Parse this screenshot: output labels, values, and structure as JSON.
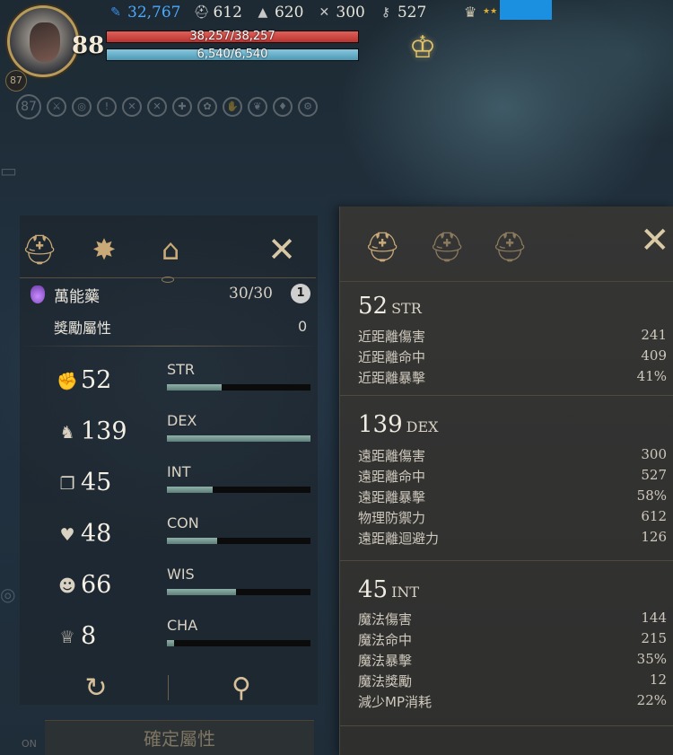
{
  "hud": {
    "level": "88",
    "small_badge": "87",
    "resources": [
      {
        "icon": "feather-icon",
        "value": "32,767"
      },
      {
        "icon": "helmet-icon",
        "value": "612"
      },
      {
        "icon": "wizard-hat-icon",
        "value": "620"
      },
      {
        "icon": "crossbow-icon",
        "value": "300"
      },
      {
        "icon": "crossed-keys-icon",
        "value": "527"
      }
    ],
    "hp": "38,257/38,257",
    "mp": "6,540/6,540"
  },
  "left_panel": {
    "potion": {
      "label": "萬能藥",
      "count": "30/30",
      "info": "1"
    },
    "bonus": {
      "label": "獎勵屬性",
      "value": "0"
    },
    "stats": [
      {
        "name": "STR",
        "value": "52",
        "icon": "muscle-icon",
        "fill": 0.38
      },
      {
        "name": "DEX",
        "value": "139",
        "icon": "boot-icon",
        "fill": 1.0
      },
      {
        "name": "INT",
        "value": "45",
        "icon": "book-icon",
        "fill": 0.32
      },
      {
        "name": "CON",
        "value": "48",
        "icon": "heartbeat-icon",
        "fill": 0.35
      },
      {
        "name": "WIS",
        "value": "66",
        "icon": "head-icon",
        "fill": 0.48
      },
      {
        "name": "CHA",
        "value": "8",
        "icon": "crown-icon",
        "fill": 0.05
      }
    ],
    "confirm_label": "確定屬性",
    "toggle_label": "ON"
  },
  "right_panel": {
    "sections": [
      {
        "value": "52",
        "abbr": "STR",
        "lines": [
          {
            "label": "近距離傷害",
            "value": "241"
          },
          {
            "label": "近距離命中",
            "value": "409"
          },
          {
            "label": "近距離暴擊",
            "value": "41%"
          }
        ]
      },
      {
        "value": "139",
        "abbr": "DEX",
        "lines": [
          {
            "label": "遠距離傷害",
            "value": "300"
          },
          {
            "label": "遠距離命中",
            "value": "527"
          },
          {
            "label": "遠距離暴擊",
            "value": "58%"
          },
          {
            "label": "物理防禦力",
            "value": "612"
          },
          {
            "label": "遠距離迴避力",
            "value": "126"
          }
        ]
      },
      {
        "value": "45",
        "abbr": "INT",
        "lines": [
          {
            "label": "魔法傷害",
            "value": "144"
          },
          {
            "label": "魔法命中",
            "value": "215"
          },
          {
            "label": "魔法暴擊",
            "value": "35%"
          },
          {
            "label": "魔法獎勵",
            "value": "12"
          },
          {
            "label": "減少MP消耗",
            "value": "22%"
          }
        ]
      }
    ]
  },
  "colors": {
    "hp": "#c9413c",
    "mp": "#6fb2cc",
    "accent": "#c9a978",
    "feather": "#4aa8ff"
  }
}
